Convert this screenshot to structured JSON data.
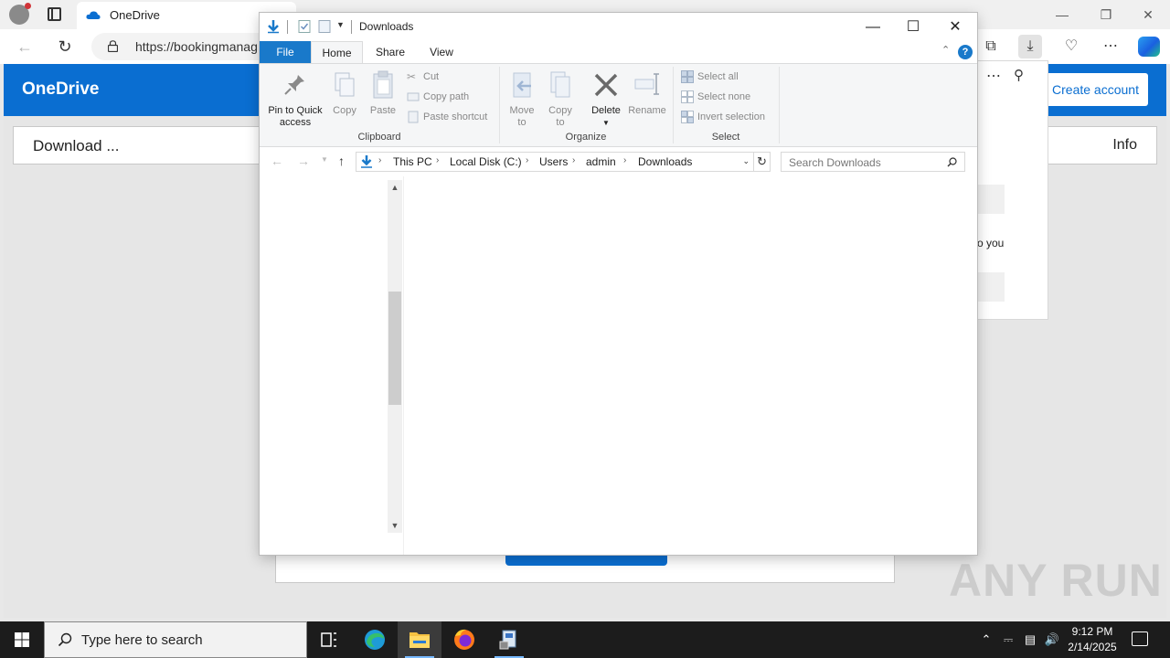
{
  "browser": {
    "tab_title": "OneDrive",
    "url": "https://bookingmanag"
  },
  "onedrive": {
    "brand": "OneDrive",
    "create_account": "Create account",
    "bar_text": "Download ...",
    "info": "Info"
  },
  "downloads_panel": {
    "partial_text": "o you"
  },
  "watermark": "ANY RUN",
  "explorer": {
    "title": "Downloads",
    "tabs": [
      "File",
      "Home",
      "Share",
      "View"
    ],
    "active_tab": "Home",
    "ribbon": {
      "pin_label_1": "Pin to Quick",
      "pin_label_2": "access",
      "copy": "Copy",
      "paste": "Paste",
      "cut": "Cut",
      "copy_path": "Copy path",
      "paste_shortcut": "Paste shortcut",
      "clipboard_group": "Clipboard",
      "move_1": "Move",
      "move_2": "to",
      "copyto_1": "Copy",
      "copyto_2": "to",
      "delete": "Delete",
      "rename": "Rename",
      "organize_group": "Organize",
      "select_all": "Select all",
      "select_none": "Select none",
      "invert_selection": "Invert selection",
      "select_group": "Select"
    },
    "breadcrumb": [
      "This PC",
      "Local Disk (C:)",
      "Users",
      "admin",
      "Downloads"
    ],
    "search_placeholder": "Search Downloads"
  },
  "taskbar": {
    "search_placeholder": "Type here to search",
    "time": "9:12 PM",
    "date": "2/14/2025"
  },
  "colors": {
    "onedrive_blue": "#0a6ed1",
    "ribbon_file_tab": "#1979ca",
    "taskbar": "#1c1c1c"
  }
}
